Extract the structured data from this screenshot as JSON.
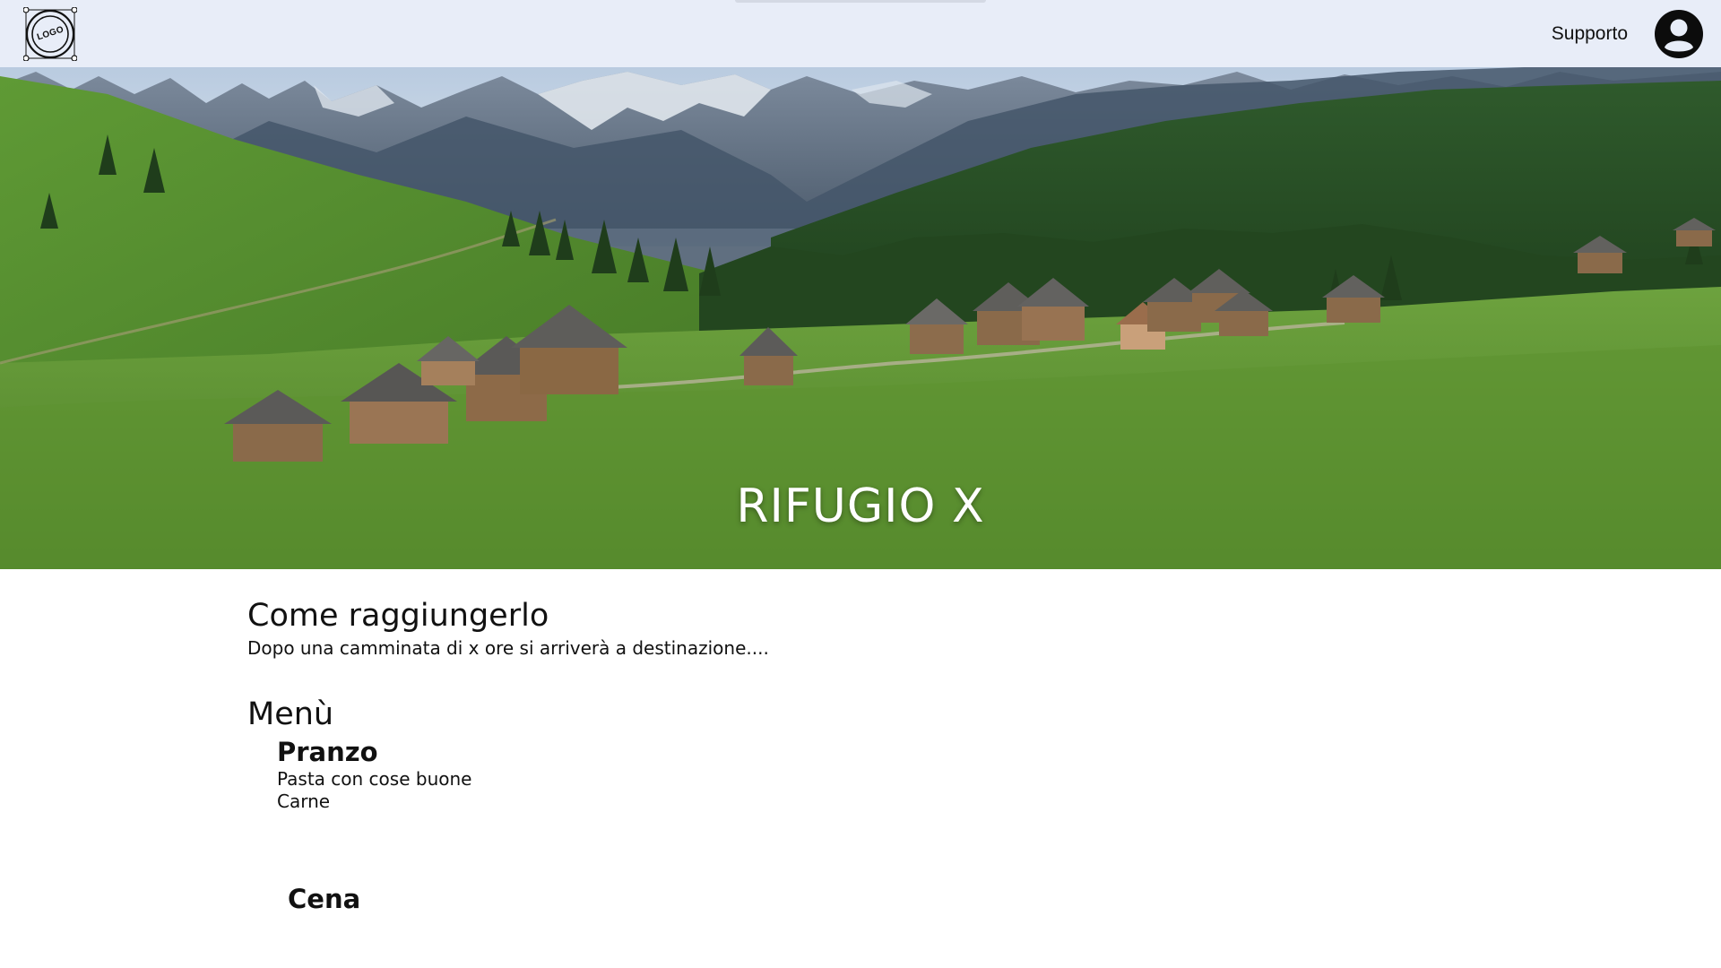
{
  "header": {
    "logo_text": "LOGO",
    "support_label": "Supporto",
    "avatar_icon": "user-circle-icon"
  },
  "hero": {
    "title": "RIFUGIO X"
  },
  "directions": {
    "title": "Come raggiungerlo",
    "text": "Dopo una camminata di x ore si arriverà a destinazione...."
  },
  "menu": {
    "title": "Menù",
    "lunch": {
      "title": "Pranzo",
      "items": [
        "Pasta con cose buone",
        "Carne"
      ]
    },
    "dinner": {
      "title": "Cena"
    }
  },
  "colors": {
    "topbar_bg": "#e8edf8",
    "text": "#111111",
    "hero_title": "#ffffff"
  }
}
